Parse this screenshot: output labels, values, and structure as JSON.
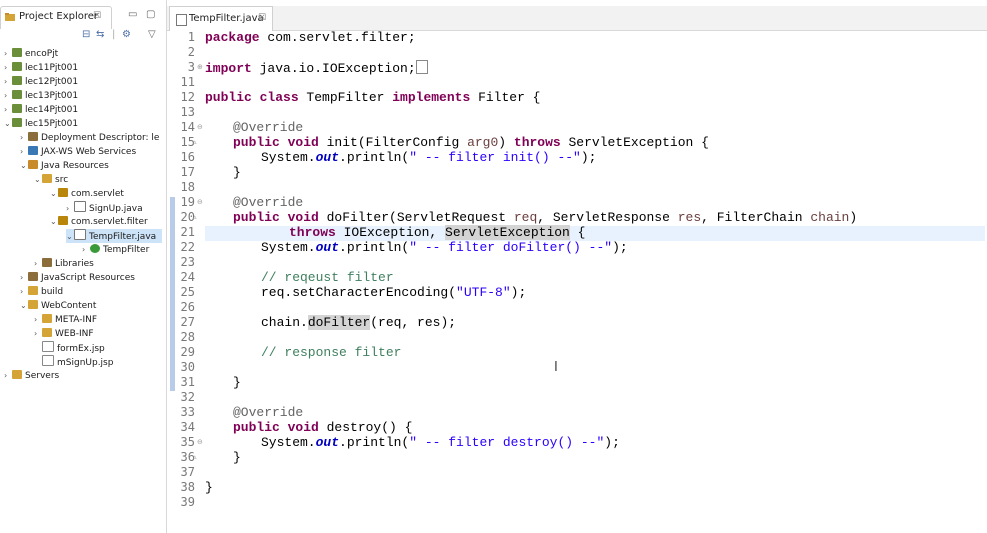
{
  "project_explorer": {
    "title": "Project Explorer",
    "close": "☒",
    "tree": [
      {
        "label": "encoPjt",
        "icon_color": "#6b8e3a"
      },
      {
        "label": "lec11Pjt001",
        "icon_color": "#6b8e3a"
      },
      {
        "label": "lec12Pjt001",
        "icon_color": "#6b8e3a"
      },
      {
        "label": "lec13Pjt001",
        "icon_color": "#6b8e3a"
      },
      {
        "label": "lec14Pjt001",
        "icon_color": "#6b8e3a"
      },
      {
        "label": "lec15Pjt001",
        "icon_color": "#6b8e3a"
      },
      {
        "label": "Deployment Descriptor: le",
        "icon_color": "#8a6d3b"
      },
      {
        "label": "JAX-WS Web Services",
        "icon_color": "#3a78b5"
      },
      {
        "label": "Java Resources",
        "icon_color": "#c98a2b"
      },
      {
        "label": "src",
        "icon_color": "#d4a437"
      },
      {
        "label": "com.servlet",
        "icon_color": "#b8860b"
      },
      {
        "label": "SignUp.java",
        "icon_color": "#777777"
      },
      {
        "label": "com.servlet.filter",
        "icon_color": "#b8860b"
      },
      {
        "label": "TempFilter.java",
        "icon_color": "#777777"
      },
      {
        "label": "TempFilter",
        "icon_color": "#3a9a3a"
      },
      {
        "label": "Libraries",
        "icon_color": "#8a6d3b"
      },
      {
        "label": "JavaScript Resources",
        "icon_color": "#8a6d3b"
      },
      {
        "label": "build",
        "icon_color": "#d4a437"
      },
      {
        "label": "WebContent",
        "icon_color": "#d4a437"
      },
      {
        "label": "META-INF",
        "icon_color": "#d4a437"
      },
      {
        "label": "WEB-INF",
        "icon_color": "#d4a437"
      },
      {
        "label": "formEx.jsp",
        "icon_color": "#888888"
      },
      {
        "label": "mSignUp.jsp",
        "icon_color": "#888888"
      },
      {
        "label": "Servers",
        "icon_color": "#d4a437"
      }
    ]
  },
  "editor": {
    "tab_title": "TempFilter.java",
    "tab_close": "☒",
    "line_numbers": [
      "1",
      "2",
      "3",
      "11",
      "12",
      "13",
      "14",
      "15",
      "16",
      "17",
      "18",
      "19",
      "20",
      "21",
      "22",
      "23",
      "24",
      "25",
      "26",
      "27",
      "28",
      "29",
      "30",
      "31",
      "32",
      "33",
      "34",
      "35",
      "36",
      "37",
      "38",
      "39"
    ],
    "lines": {
      "l1_kw": "package",
      "l1_rest": " com.servlet.filter;",
      "l3_kw": "import",
      "l3_rest": " java.io.IOException;",
      "l12_kw1": "public class",
      "l12_mid": " TempFilter ",
      "l12_kw2": "implements",
      "l12_rest": " Filter {",
      "l14_an": "@Override",
      "l15_kw": "public void",
      "l15_a": " init(FilterConfig ",
      "l15_param": "arg0",
      "l15_b": ") ",
      "l15_kw2": "throws",
      "l15_c": " ServletException {",
      "l16_a": "System.",
      "l16_out": "out",
      "l16_b": ".println(",
      "l16_str": "\" -- filter init() --\"",
      "l16_c": ");",
      "l17": "}",
      "l19_an": "@Override",
      "l20_kw": "public void",
      "l20_a": " doFilter(ServletRequest ",
      "l20_p1": "req",
      "l20_b": ", ServletResponse ",
      "l20_p2": "res",
      "l20_c": ", FilterChain ",
      "l20_p3": "chain",
      "l20_d": ")",
      "l21_kw": "throws",
      "l21_a": " IOException, ",
      "l21_occ": "ServletException",
      "l21_b": " {",
      "l22_a": "System.",
      "l22_out": "out",
      "l22_b": ".println(",
      "l22_str": "\" -- filter doFilter() --\"",
      "l22_c": ");",
      "l24_cm": "// reqeust filter",
      "l25_a": "req.setCharacterEncoding(",
      "l25_str": "\"UTF-8\"",
      "l25_b": ");",
      "l27_a": "chain.",
      "l27_occ": "doFilter",
      "l27_b": "(req, res);",
      "l29_cm": "// response filter",
      "l31": "}",
      "l33_an": "@Override",
      "l34_kw": "public void",
      "l34_a": " destroy() {",
      "l35_a": "System.",
      "l35_out": "out",
      "l35_b": ".println(",
      "l35_str": "\" -- filter destroy() --\"",
      "l35_c": ");",
      "l36": "}",
      "l38": "}"
    },
    "cursor_glyph": "I"
  }
}
